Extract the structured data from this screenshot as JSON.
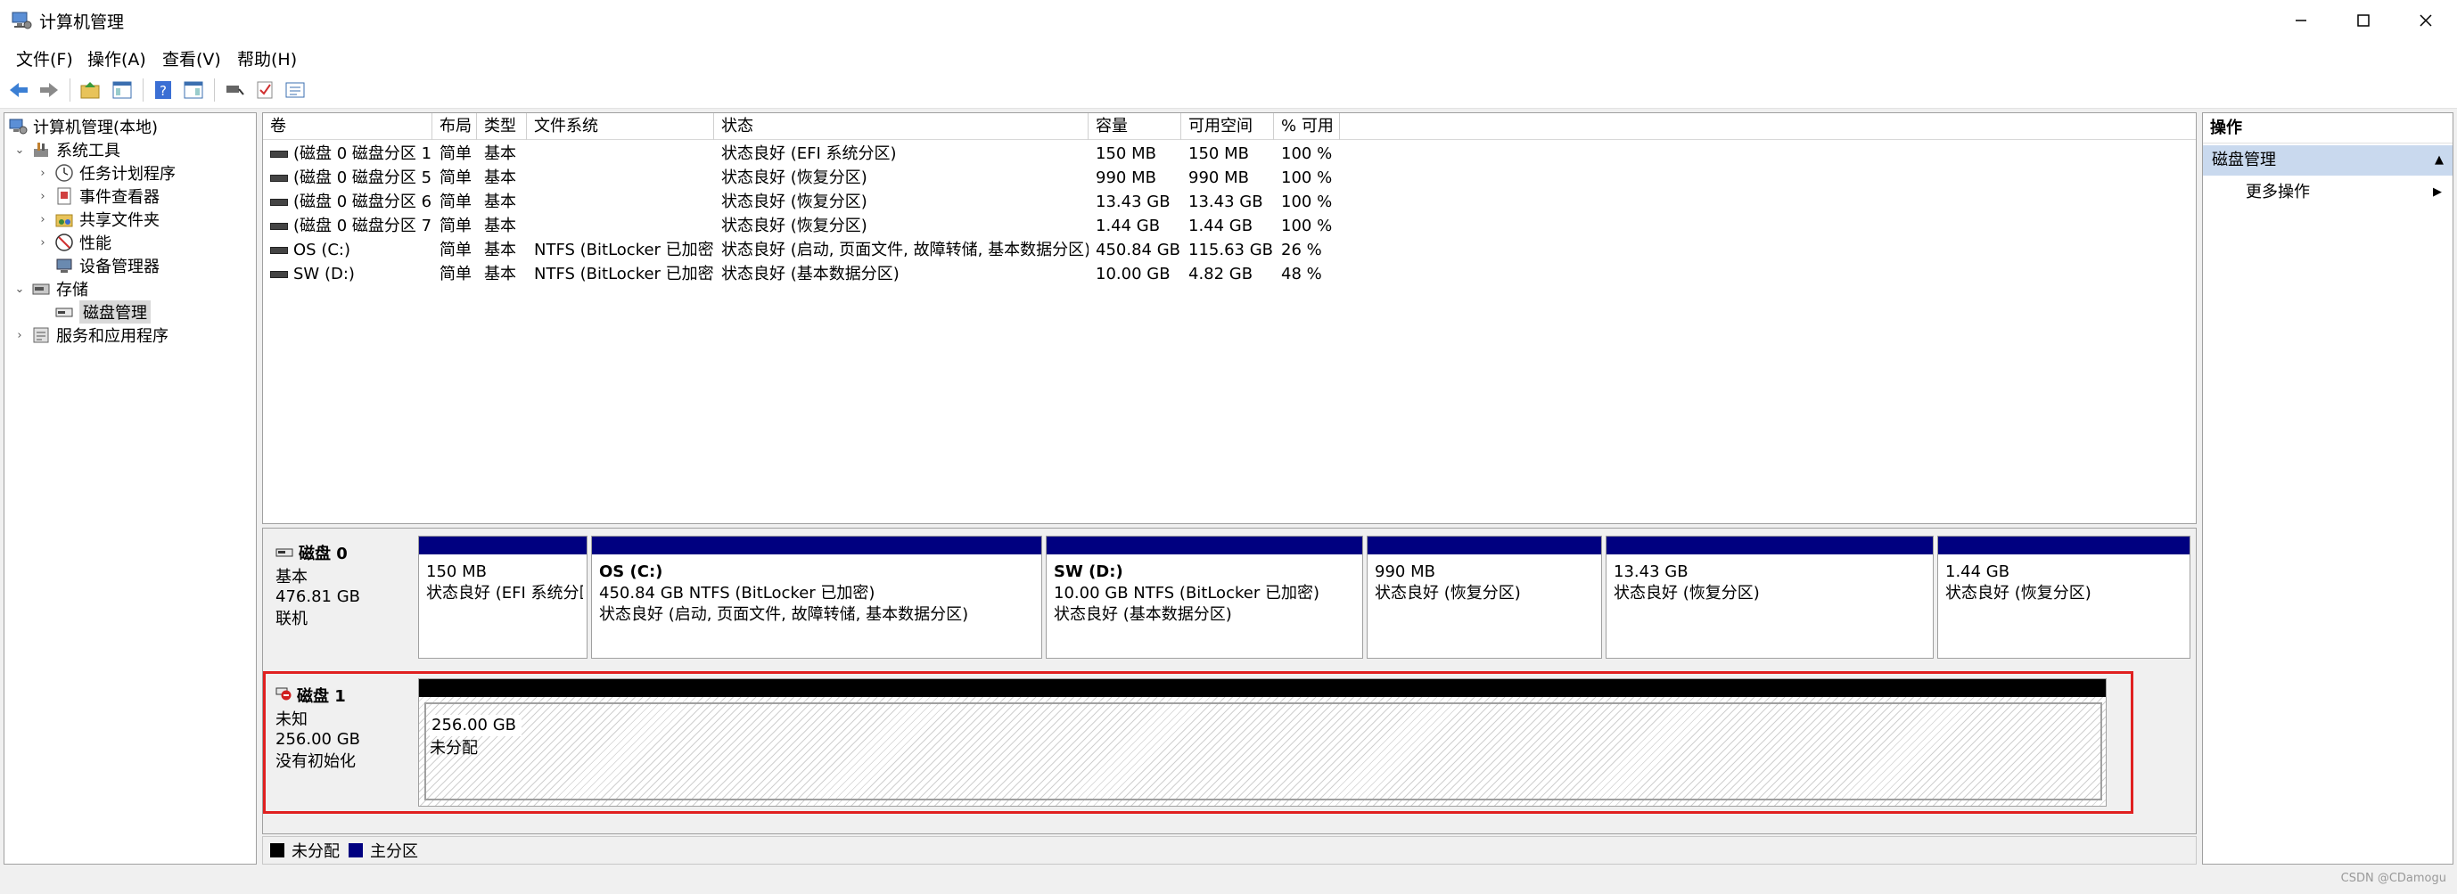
{
  "window": {
    "title": "计算机管理"
  },
  "menu": [
    "文件(F)",
    "操作(A)",
    "查看(V)",
    "帮助(H)"
  ],
  "toolbar": {
    "buttons": [
      "back-icon",
      "forward-icon",
      "up-folder-icon",
      "show-tree-icon",
      "help-icon",
      "show-hide-icon",
      "connect-icon",
      "check-icon",
      "properties-icon"
    ]
  },
  "tree": {
    "root": "计算机管理(本地)",
    "system_tools": "系统工具",
    "task_scheduler": "任务计划程序",
    "event_viewer": "事件查看器",
    "shared_folders": "共享文件夹",
    "performance": "性能",
    "device_manager": "设备管理器",
    "storage": "存储",
    "disk_management": "磁盘管理",
    "services_apps": "服务和应用程序"
  },
  "volume_table": {
    "columns": [
      "卷",
      "布局",
      "类型",
      "文件系统",
      "状态",
      "容量",
      "可用空间",
      "% 可用"
    ],
    "rows": [
      [
        "(磁盘 0 磁盘分区 1)",
        "简单",
        "基本",
        "",
        "状态良好 (EFI 系统分区)",
        "150 MB",
        "150 MB",
        "100 %"
      ],
      [
        "(磁盘 0 磁盘分区 5)",
        "简单",
        "基本",
        "",
        "状态良好 (恢复分区)",
        "990 MB",
        "990 MB",
        "100 %"
      ],
      [
        "(磁盘 0 磁盘分区 6)",
        "简单",
        "基本",
        "",
        "状态良好 (恢复分区)",
        "13.43 GB",
        "13.43 GB",
        "100 %"
      ],
      [
        "(磁盘 0 磁盘分区 7)",
        "简单",
        "基本",
        "",
        "状态良好 (恢复分区)",
        "1.44 GB",
        "1.44 GB",
        "100 %"
      ],
      [
        "OS (C:)",
        "简单",
        "基本",
        "NTFS (BitLocker 已加密)",
        "状态良好 (启动, 页面文件, 故障转储, 基本数据分区)",
        "450.84 GB",
        "115.63 GB",
        "26 %"
      ],
      [
        "SW (D:)",
        "简单",
        "基本",
        "NTFS (BitLocker 已加密)",
        "状态良好 (基本数据分区)",
        "10.00 GB",
        "4.82 GB",
        "48 %"
      ]
    ]
  },
  "disk0": {
    "name": "磁盘 0",
    "type": "基本",
    "size": "476.81 GB",
    "status": "联机",
    "partitions": [
      {
        "name": "",
        "line1": "150 MB",
        "line2": "状态良好 (EFI 系统分区)"
      },
      {
        "name": "OS  (C:)",
        "line1": "450.84 GB NTFS (BitLocker 已加密)",
        "line2": "状态良好 (启动, 页面文件, 故障转储, 基本数据分区)"
      },
      {
        "name": "SW  (D:)",
        "line1": "10.00 GB NTFS (BitLocker 已加密)",
        "line2": "状态良好 (基本数据分区)"
      },
      {
        "name": "",
        "line1": "990 MB",
        "line2": "状态良好 (恢复分区)"
      },
      {
        "name": "",
        "line1": "13.43 GB",
        "line2": "状态良好 (恢复分区)"
      },
      {
        "name": "",
        "line1": "1.44 GB",
        "line2": "状态良好 (恢复分区)"
      }
    ]
  },
  "disk1": {
    "name": "磁盘 1",
    "type": "未知",
    "size": "256.00 GB",
    "status": "没有初始化",
    "unallocated_size": "256.00 GB",
    "unallocated_label": "未分配"
  },
  "legend": {
    "unallocated": "未分配",
    "primary": "主分区",
    "unallocated_color": "#000000",
    "primary_color": "#000080"
  },
  "actions": {
    "header": "操作",
    "section": "磁盘管理",
    "more": "更多操作"
  },
  "watermark": "CSDN @CDamogu",
  "colors": {
    "highlight_box": "#e02020",
    "selected_section": "#c9d9ee"
  }
}
